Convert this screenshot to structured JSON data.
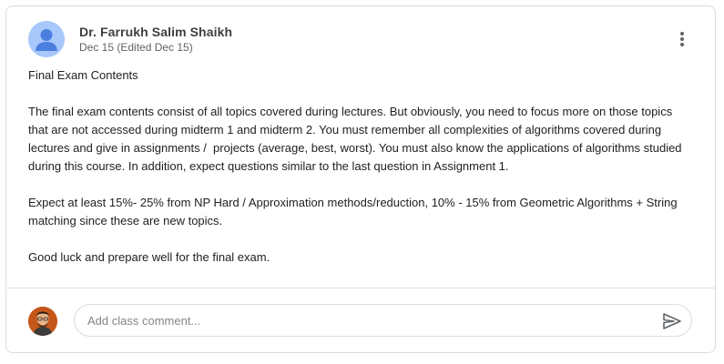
{
  "post": {
    "author": "Dr. Farrukh Salim Shaikh",
    "date": "Dec 15 (Edited Dec 15)",
    "body": "Final Exam Contents\n\nThe final exam contents consist of all topics covered during lectures. But obviously, you need to focus more on those topics\nthat are not accessed during midterm 1 and midterm 2. You must remember all complexities of algorithms covered during\nlectures and give in assignments /  projects (average, best, worst). You must also know the applications of algorithms studied\nduring this course. In addition, expect questions similar to the last question in Assignment 1.\n\nExpect at least 15%- 25% from NP Hard / Approximation methods/reduction, 10% - 15% from Geometric Algorithms + String\nmatching since these are new topics.\n\nGood luck and prepare well for the final exam."
  },
  "comment": {
    "placeholder": "Add class comment..."
  },
  "icons": {
    "author_avatar": "person-avatar-icon",
    "more": "more-vert-icon",
    "send": "send-icon",
    "user_avatar": "user-avatar"
  },
  "colors": {
    "avatar_bg": "#a8c7fa",
    "avatar_fg": "#4285f4",
    "border": "#dadce0",
    "muted": "#5f6368"
  }
}
